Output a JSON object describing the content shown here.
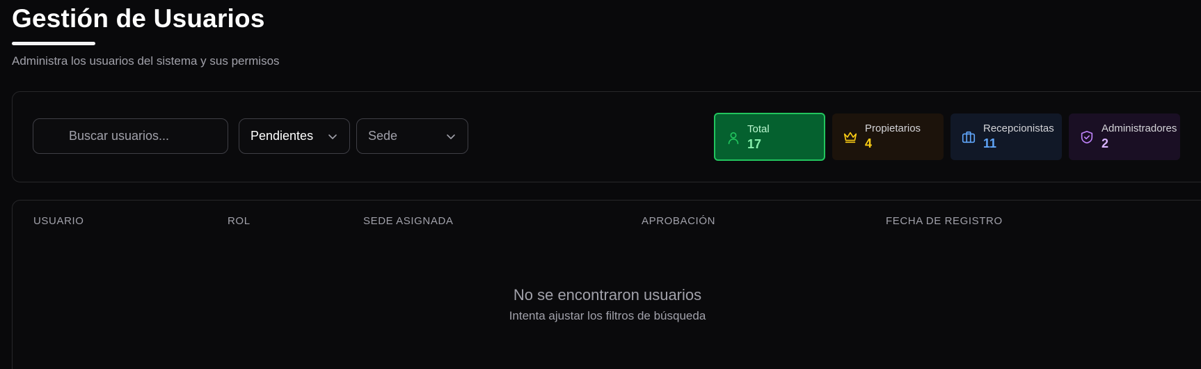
{
  "header": {
    "title": "Gestión de Usuarios",
    "subtitle": "Administra los usuarios del sistema y sus permisos"
  },
  "filters": {
    "search_placeholder": "Buscar usuarios...",
    "search_value": "",
    "status_value": "Pendientes",
    "sede_value": "Sede"
  },
  "stats": [
    {
      "label": "Total",
      "count": "17",
      "icon": "user-icon",
      "color": "#22c55e"
    },
    {
      "label": "Propietarios",
      "count": "4",
      "icon": "crown-icon",
      "color": "#facc15"
    },
    {
      "label": "Recepcionistas",
      "count": "11",
      "icon": "briefcase-icon",
      "color": "#60a5fa"
    },
    {
      "label": "Administradores",
      "count": "2",
      "icon": "shield-check-icon",
      "color": "#c084fc"
    }
  ],
  "table": {
    "columns": [
      "USUARIO",
      "ROL",
      "SEDE ASIGNADA",
      "APROBACIÓN",
      "FECHA DE REGISTRO"
    ],
    "rows": [],
    "empty_title": "No se encontraron usuarios",
    "empty_subtitle": "Intenta ajustar los filtros de búsqueda"
  }
}
